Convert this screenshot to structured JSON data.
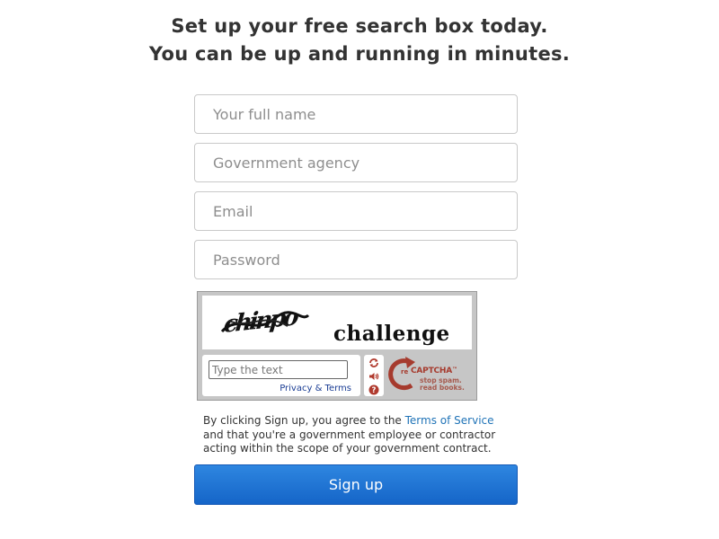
{
  "heading": {
    "line1": "Set up your free search box today.",
    "line2": "You can be up and running in minutes."
  },
  "form": {
    "full_name": {
      "placeholder": "Your full name",
      "value": ""
    },
    "agency": {
      "placeholder": "Government agency",
      "value": ""
    },
    "email": {
      "placeholder": "Email",
      "value": ""
    },
    "password": {
      "placeholder": "Password",
      "value": ""
    }
  },
  "captcha": {
    "distorted_word": "chinpo",
    "challenge_word": "challenge",
    "input_placeholder": "Type the text",
    "privacy_label": "Privacy & Terms",
    "brand_prefix": "re",
    "brand_name": "CAPTCHA",
    "trademark": "™",
    "tagline_1": "stop spam.",
    "tagline_2": "read books.",
    "controls": [
      "refresh-icon",
      "audio-icon",
      "help-icon"
    ],
    "brand_color": "#a63b2e"
  },
  "terms": {
    "prefix": "By clicking Sign up, you agree to the ",
    "link": "Terms of Service",
    "suffix": " and that you're a government employee or contractor acting within the scope of your government contract."
  },
  "signup": {
    "label": "Sign up",
    "color": "#1f73d6"
  },
  "colors": {
    "link": "#1f73b7",
    "text": "#333333"
  }
}
